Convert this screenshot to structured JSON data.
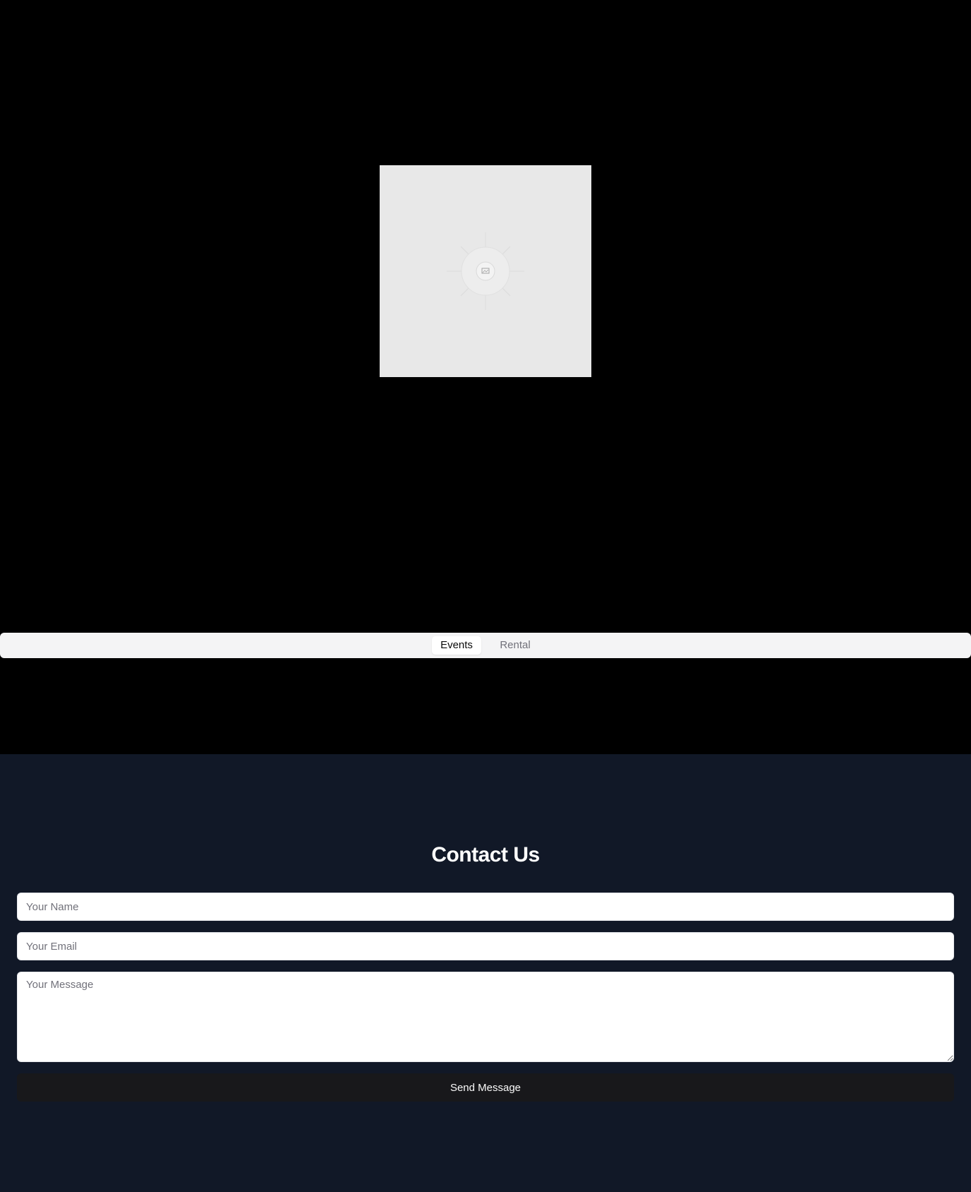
{
  "colors": {
    "hero_background": "#000000",
    "contact_background": "#111827",
    "tabs_background": "#f4f4f5",
    "button_background": "#18181b"
  },
  "hero": {
    "image_icon": "image-placeholder-icon"
  },
  "tabs": {
    "items": [
      {
        "label": "Events",
        "active": true
      },
      {
        "label": "Rental",
        "active": false
      }
    ]
  },
  "contact": {
    "title": "Contact Us",
    "name_placeholder": "Your Name",
    "email_placeholder": "Your Email",
    "message_placeholder": "Your Message",
    "submit_label": "Send Message"
  }
}
